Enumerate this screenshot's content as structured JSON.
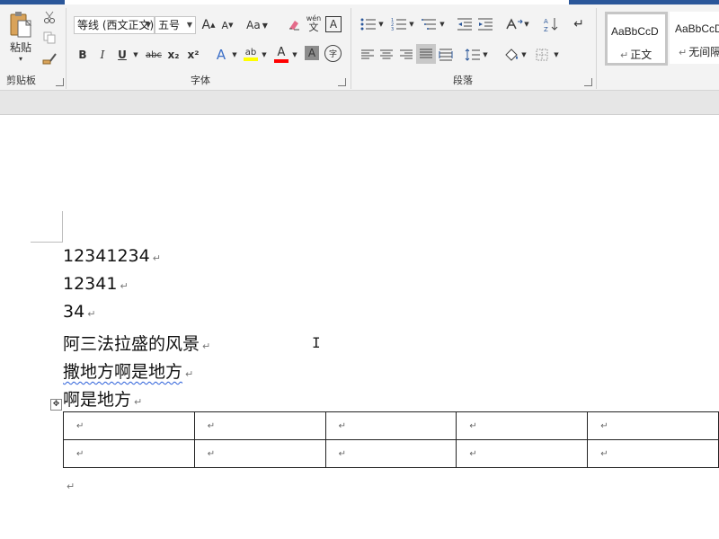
{
  "clipboard": {
    "paste_label": "粘贴",
    "paste_arrow": "▾",
    "group_label": "剪贴板"
  },
  "font": {
    "family": "等线 (西文正文)",
    "size": "五号",
    "group_label": "字体",
    "grow": "A",
    "shrink": "A",
    "case": "Aa",
    "bold": "B",
    "italic": "I",
    "underline": "U",
    "strike": "abc",
    "sub": "x₂",
    "sup": "x²",
    "effects": "A",
    "highlight": "ab",
    "color": "A",
    "shade": "A",
    "border_char": "A",
    "circle_char": "字",
    "phonetic": "wén"
  },
  "paragraph": {
    "group_label": "段落"
  },
  "styles": [
    {
      "sample": "AaBbCcD",
      "name": "正文"
    },
    {
      "sample": "AaBbCcD",
      "name": "无间隔"
    }
  ],
  "colors": {
    "accent": "#2b579a",
    "highlight": "#ffff00",
    "font_color": "#ff0000"
  },
  "document": {
    "paragraphs": [
      "12341234",
      "12341",
      "34",
      "阿三法拉盛的风景",
      "撒地方啊是地方",
      "啊是地方"
    ],
    "pilcrow": "↵",
    "table": {
      "rows": [
        [
          "↵",
          "↵",
          "↵",
          "↵",
          "↵"
        ],
        [
          "↵",
          "↵",
          "↵",
          "↵",
          "↵"
        ]
      ]
    }
  }
}
